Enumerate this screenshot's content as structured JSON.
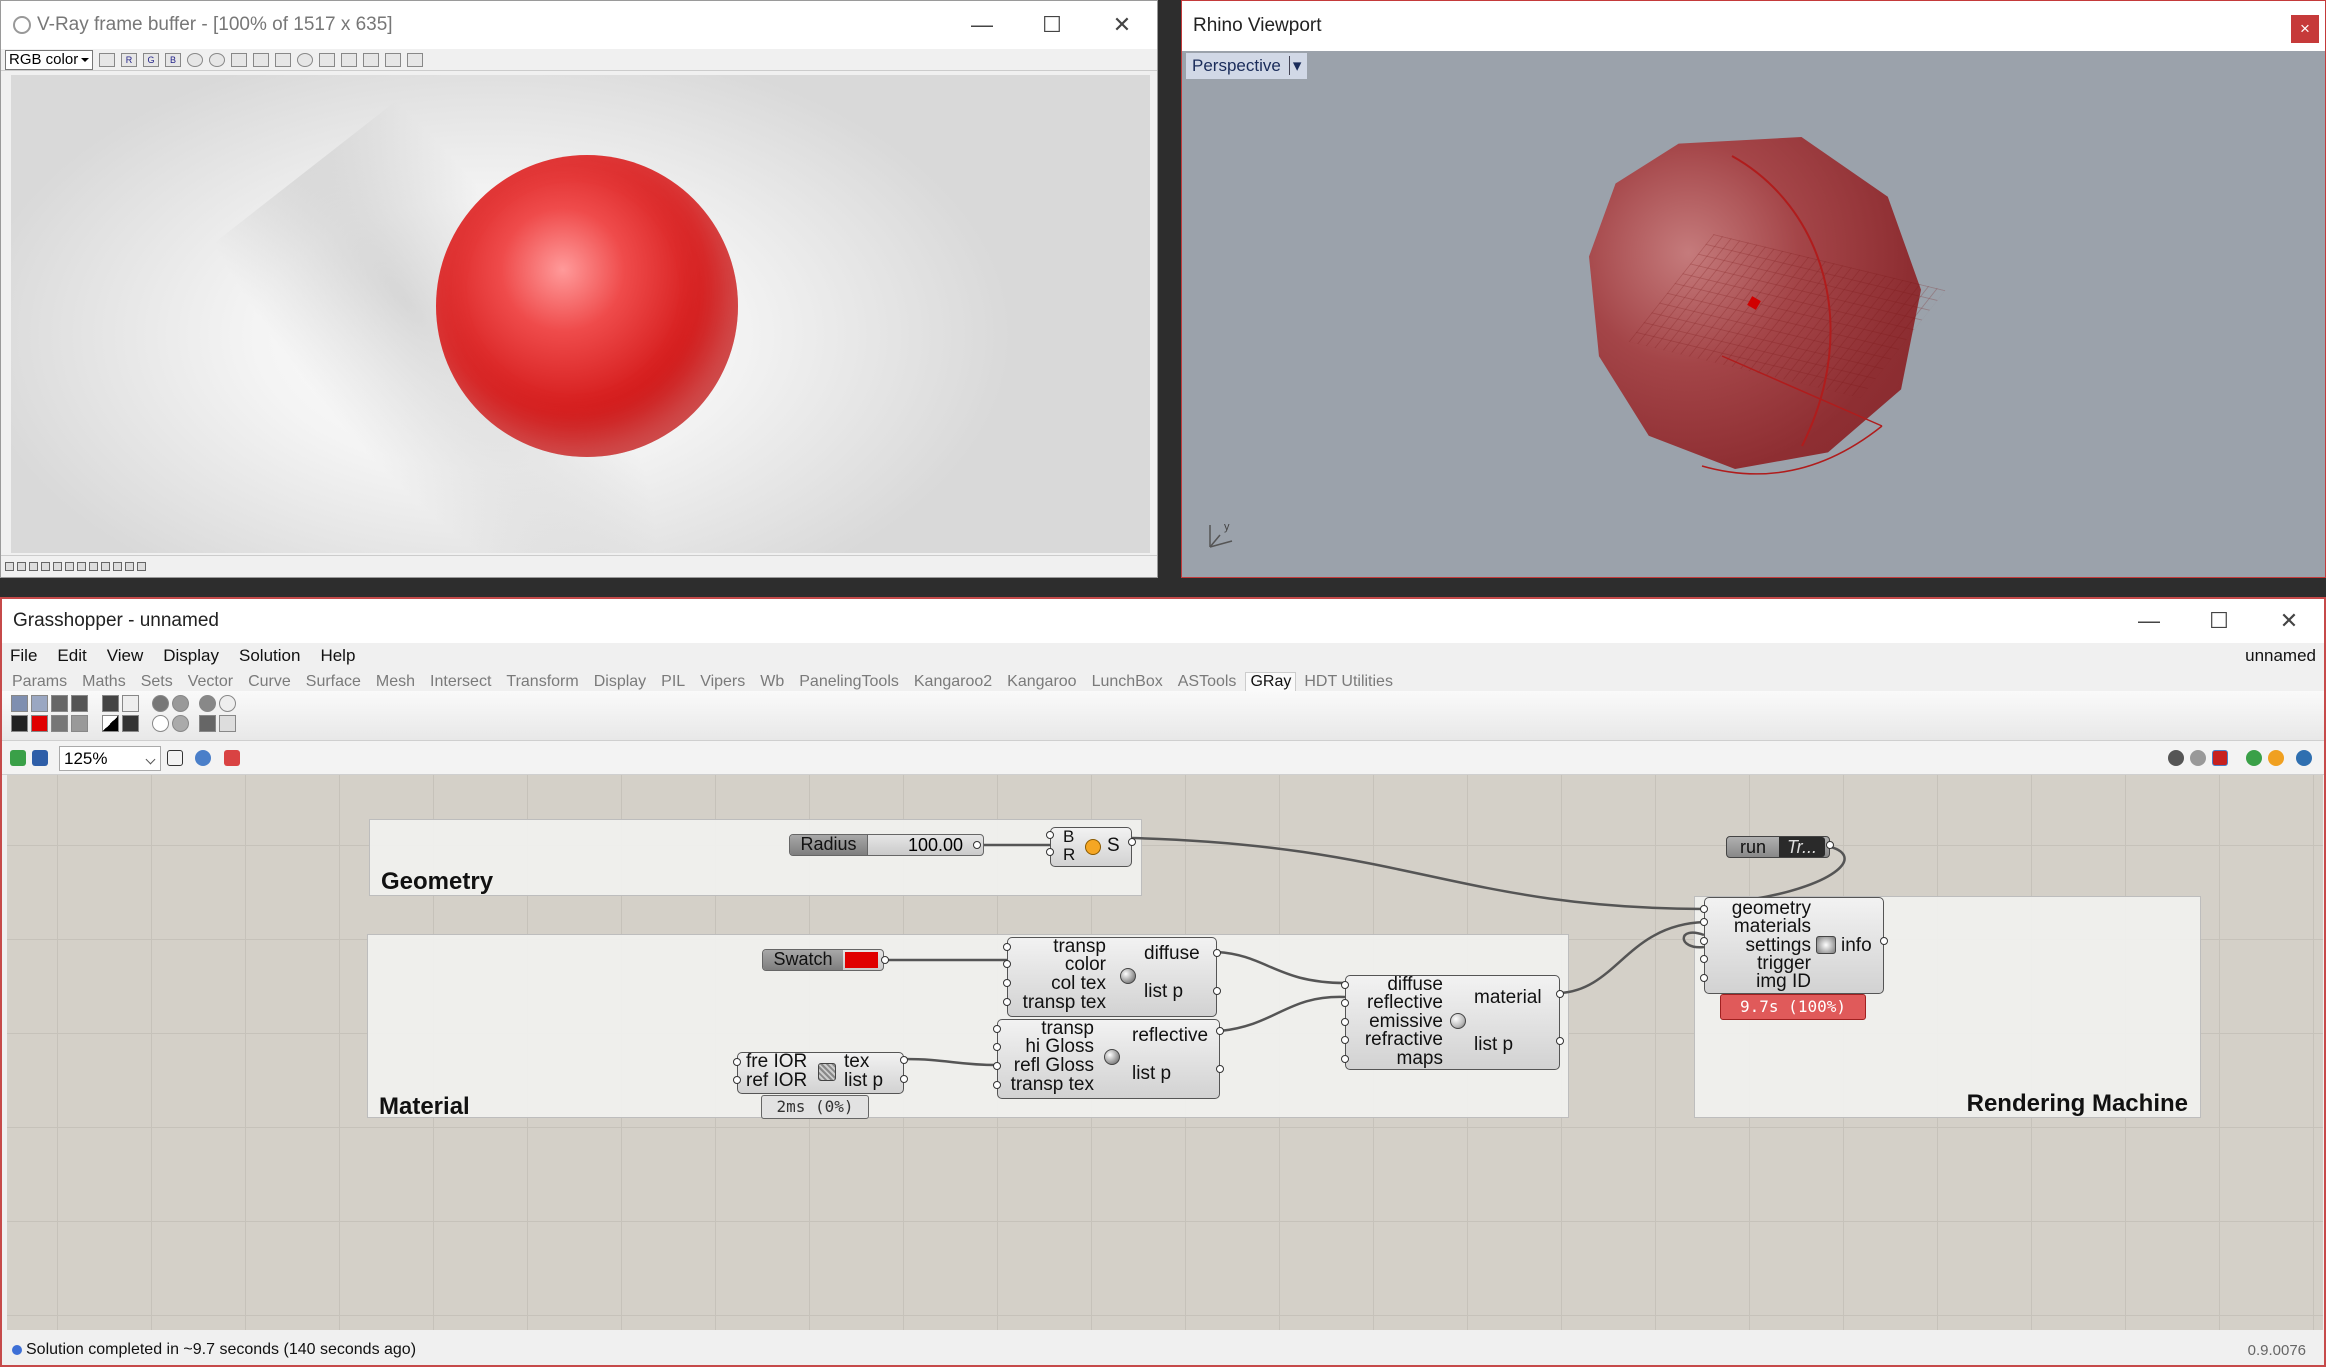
{
  "vray": {
    "title": "V-Ray frame buffer - [100% of 1517 x 635]",
    "channel": "RGB color",
    "channel_buttons": [
      "R",
      "G",
      "B"
    ]
  },
  "rhino": {
    "title": "Rhino Viewport",
    "close": "×",
    "viewport": "Perspective",
    "axis_label": "y"
  },
  "grasshopper": {
    "title": "Grasshopper - unnamed",
    "doc_name": "unnamed",
    "menu": [
      "File",
      "Edit",
      "View",
      "Display",
      "Solution",
      "Help"
    ],
    "tabs": [
      "Params",
      "Maths",
      "Sets",
      "Vector",
      "Curve",
      "Surface",
      "Mesh",
      "Intersect",
      "Transform",
      "Display",
      "PIL",
      "Vipers",
      "Wb",
      "PanelingTools",
      "Kangaroo2",
      "Kangaroo",
      "LunchBox",
      "ASTools",
      "GRay",
      "HDT Utilities"
    ],
    "active_tab": "GRay",
    "zoom": "125%",
    "groups": {
      "geometry": "Geometry",
      "material": "Material",
      "rendering": "Rendering Machine"
    },
    "components": {
      "radius": {
        "label": "Radius",
        "value": "100.00"
      },
      "sphere": {
        "inputs": [
          "B",
          "R"
        ],
        "output": "S"
      },
      "run": {
        "label": "run",
        "value": "Tr..."
      },
      "swatch": {
        "label": "Swatch"
      },
      "diffuse": {
        "inputs": [
          "transp",
          "color",
          "col tex",
          "transp tex"
        ],
        "outputs": [
          "diffuse",
          "list p"
        ]
      },
      "reflective": {
        "inputs": [
          "transp",
          "hi Gloss",
          "refl Gloss",
          "transp tex"
        ],
        "outputs": [
          "reflective",
          "list p"
        ]
      },
      "fresnel": {
        "inputs": [
          "fre IOR",
          "ref IOR"
        ],
        "outputs": [
          "tex",
          "list p"
        ],
        "time": "2ms (0%)"
      },
      "material": {
        "inputs": [
          "diffuse",
          "reflective",
          "emissive",
          "refractive",
          "maps"
        ],
        "outputs": [
          "material",
          "list p"
        ]
      },
      "renderer": {
        "inputs": [
          "geometry",
          "materials",
          "settings",
          "trigger",
          "img ID"
        ],
        "output": "info",
        "time": "9.7s (100%)"
      }
    },
    "status": "Solution completed in ~9.7 seconds (140 seconds ago)",
    "version": "0.9.0076"
  },
  "colors": {
    "swatch_red": "#e00000",
    "render_time_bg": "#e05a5a",
    "slider_orange": "#f5a623"
  }
}
